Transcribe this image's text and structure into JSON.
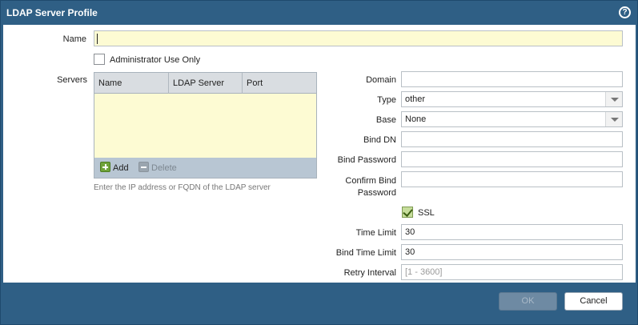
{
  "dialog": {
    "title": "LDAP Server Profile",
    "help_icon_glyph": "?"
  },
  "form": {
    "name_label": "Name",
    "name_value": "",
    "admin_only_label": "Administrator Use Only",
    "admin_only_checked": false,
    "servers_label": "Servers",
    "servers_columns": [
      "Name",
      "LDAP Server",
      "Port"
    ],
    "servers_rows": [],
    "add_label": "Add",
    "delete_label": "Delete",
    "servers_hint": "Enter the IP address or FQDN of the LDAP server",
    "domain_label": "Domain",
    "domain_value": "",
    "type_label": "Type",
    "type_value": "other",
    "base_label": "Base",
    "base_value": "None",
    "bind_dn_label": "Bind DN",
    "bind_dn_value": "",
    "bind_password_label": "Bind Password",
    "bind_password_value": "",
    "confirm_bind_label_line1": "Confirm Bind",
    "confirm_bind_label_line2": "Password",
    "confirm_bind_value": "",
    "ssl_label": "SSL",
    "ssl_checked": true,
    "time_limit_label": "Time Limit",
    "time_limit_value": "30",
    "bind_time_limit_label": "Bind Time Limit",
    "bind_time_limit_value": "30",
    "retry_interval_label": "Retry Interval",
    "retry_interval_placeholder": "[1 - 3600]"
  },
  "footer": {
    "ok_label": "OK",
    "cancel_label": "Cancel"
  },
  "colors": {
    "title_bar": "#2f5f85",
    "required_field": "#fdfbd3",
    "grid_toolbar": "#b8c6d3"
  }
}
